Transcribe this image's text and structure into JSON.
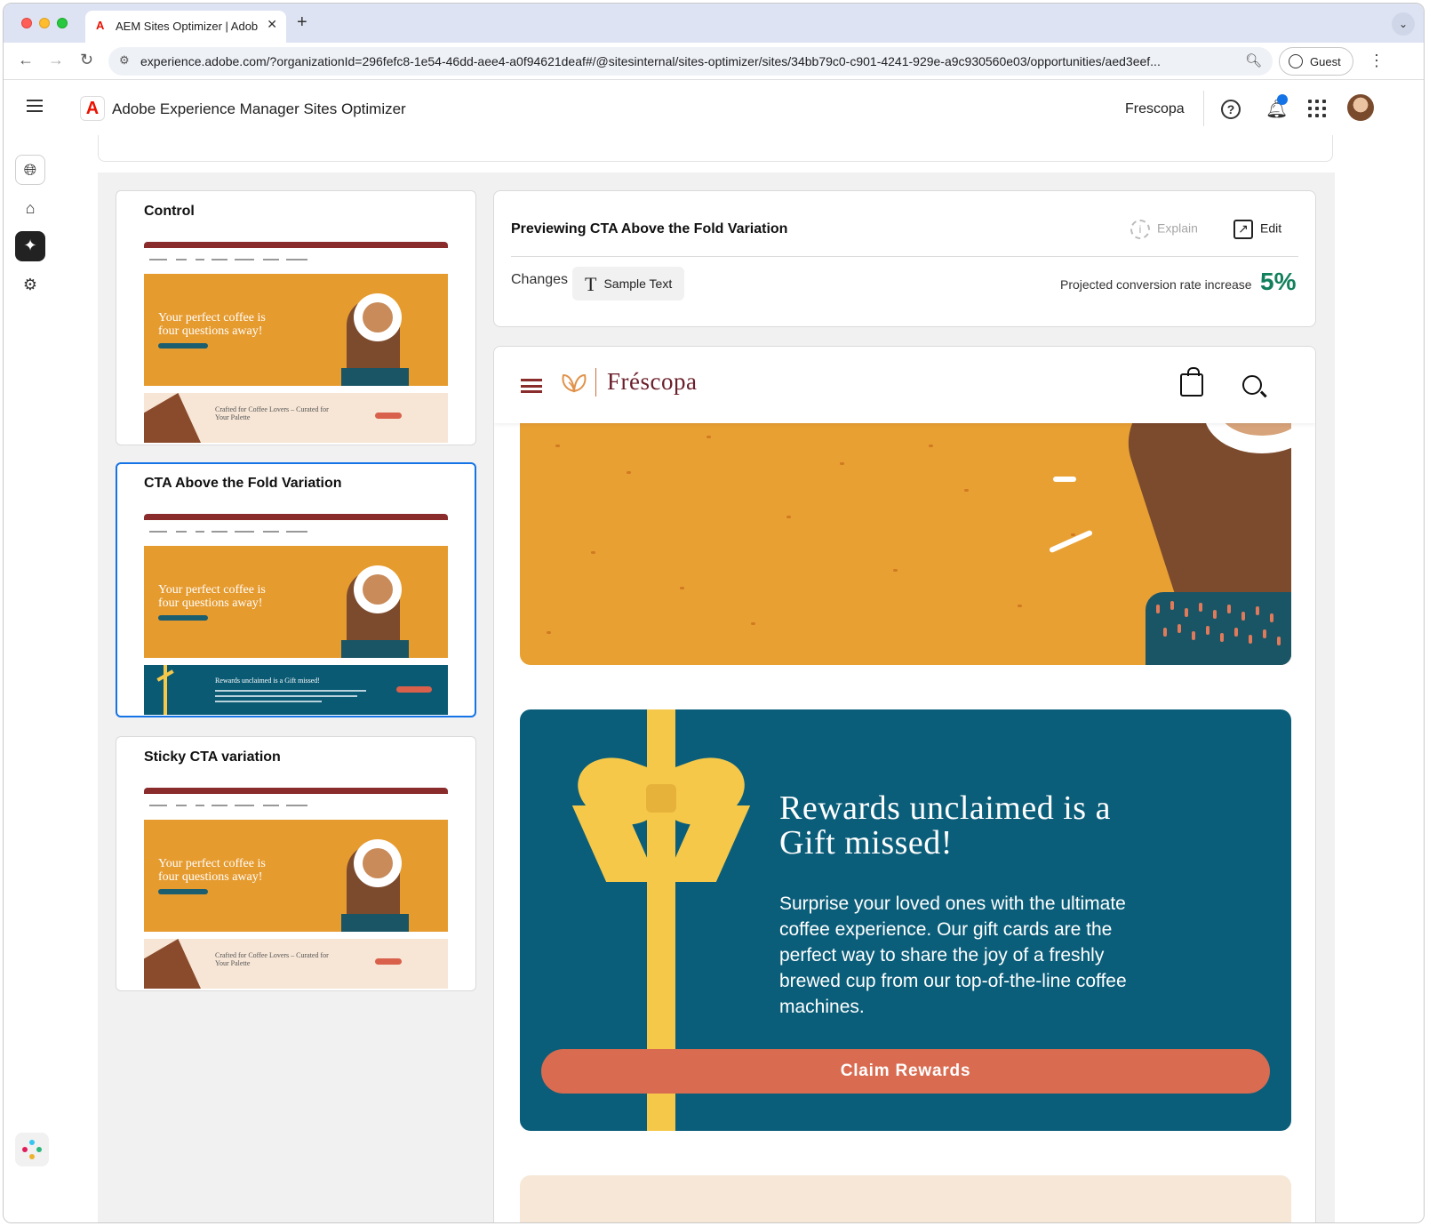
{
  "browser": {
    "tab_title": "AEM Sites Optimizer | Adobe",
    "tab_close": "✕",
    "new_tab": "+",
    "url": "experience.adobe.com/?organizationId=296fefc8-1e54-46dd-aee4-a0f94621deaf#/@sitesinternal/sites-optimizer/sites/34bb79c0-c901-4241-929e-a9c930560e03/opportunities/aed3eef...",
    "profile_label": "Guest"
  },
  "app": {
    "title": "Adobe Experience Manager Sites Optimizer",
    "org": "Frescopa"
  },
  "rail": {
    "items": [
      {
        "icon": "globe-icon"
      },
      {
        "icon": "home-icon"
      },
      {
        "icon": "opportunities-icon",
        "active": true
      },
      {
        "icon": "settings-icon"
      }
    ]
  },
  "variations": [
    {
      "title": "Control",
      "selected": false,
      "thumb_hero_text": "Your perfect coffee is four questions away!",
      "thumb_bottom_text": "Crafted for Coffee Lovers – Curated for Your Palette"
    },
    {
      "title": "CTA Above the Fold Variation",
      "selected": true,
      "thumb_hero_text": "Your perfect coffee is four questions away!",
      "thumb_bottom_text": "Rewards unclaimed is a Gift missed!"
    },
    {
      "title": "Sticky CTA variation",
      "selected": false,
      "thumb_hero_text": "Your perfect coffee is four questions away!",
      "thumb_bottom_text": "Crafted for Coffee Lovers – Curated for Your Palette"
    }
  ],
  "preview": {
    "title": "Previewing CTA Above the Fold Variation",
    "explain_label": "Explain",
    "edit_label": "Edit",
    "changes_label": "Changes",
    "change_chip": "Sample Text",
    "projected_label": "Projected conversion rate increase",
    "projected_value": "5%"
  },
  "site": {
    "brand": "Fréscopa",
    "gift": {
      "title": "Rewards unclaimed is a Gift missed!",
      "body": "Surprise your loved ones with the ultimate coffee experience. Our gift cards are the perfect way to share the joy of a freshly brewed cup from our top-of-the-line coffee machines.",
      "button": "Claim Rewards"
    }
  },
  "colors": {
    "accent": "#1473e6",
    "positive": "#12805c",
    "brand_maroon": "#6b1f2a",
    "hero_orange": "#e8a033",
    "gift_teal": "#0b5e7a",
    "gift_ribbon": "#f5c84a",
    "cta_coral": "#d96b50"
  }
}
